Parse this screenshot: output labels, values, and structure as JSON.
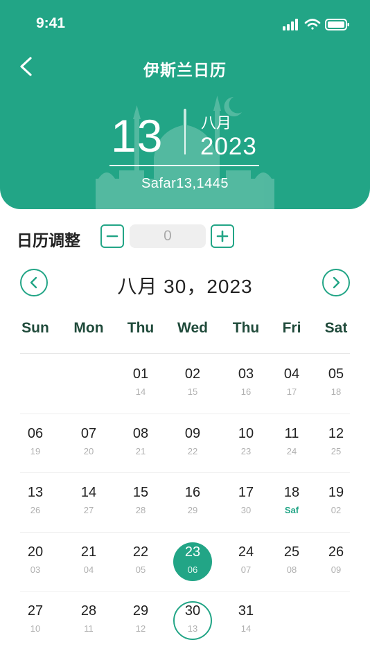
{
  "status_bar": {
    "time": "9:41"
  },
  "header": {
    "title": "伊斯兰日历",
    "day": "13",
    "month": "八月",
    "year": "2023",
    "hijri": "Safar13,1445"
  },
  "adjust": {
    "label": "日历调整",
    "value": "0"
  },
  "calendar": {
    "month_title": "八月 30，2023",
    "weekdays": [
      "Sun",
      "Mon",
      "Thu",
      "Wed",
      "Thu",
      "Fri",
      "Sat"
    ],
    "weeks": [
      [
        null,
        null,
        {
          "d": "01",
          "s": "14"
        },
        {
          "d": "02",
          "s": "15"
        },
        {
          "d": "03",
          "s": "16"
        },
        {
          "d": "04",
          "s": "17"
        },
        {
          "d": "05",
          "s": "18"
        }
      ],
      [
        {
          "d": "06",
          "s": "19"
        },
        {
          "d": "07",
          "s": "20"
        },
        {
          "d": "08",
          "s": "21"
        },
        {
          "d": "09",
          "s": "22"
        },
        {
          "d": "10",
          "s": "23"
        },
        {
          "d": "11",
          "s": "24"
        },
        {
          "d": "12",
          "s": "25"
        }
      ],
      [
        {
          "d": "13",
          "s": "26"
        },
        {
          "d": "14",
          "s": "27"
        },
        {
          "d": "15",
          "s": "28"
        },
        {
          "d": "16",
          "s": "29"
        },
        {
          "d": "17",
          "s": "30"
        },
        {
          "d": "18",
          "s": "Saf",
          "accent": true
        },
        {
          "d": "19",
          "s": "02"
        }
      ],
      [
        {
          "d": "20",
          "s": "03"
        },
        {
          "d": "21",
          "s": "04"
        },
        {
          "d": "22",
          "s": "05"
        },
        {
          "d": "23",
          "s": "06",
          "state": "selected"
        },
        {
          "d": "24",
          "s": "07"
        },
        {
          "d": "25",
          "s": "08"
        },
        {
          "d": "26",
          "s": "09"
        }
      ],
      [
        {
          "d": "27",
          "s": "10"
        },
        {
          "d": "28",
          "s": "11"
        },
        {
          "d": "29",
          "s": "12"
        },
        {
          "d": "30",
          "s": "13",
          "state": "today"
        },
        {
          "d": "31",
          "s": "14"
        },
        null,
        null
      ]
    ]
  },
  "colors": {
    "accent": "#22a586",
    "secondary_text": "#b0b0b0"
  }
}
